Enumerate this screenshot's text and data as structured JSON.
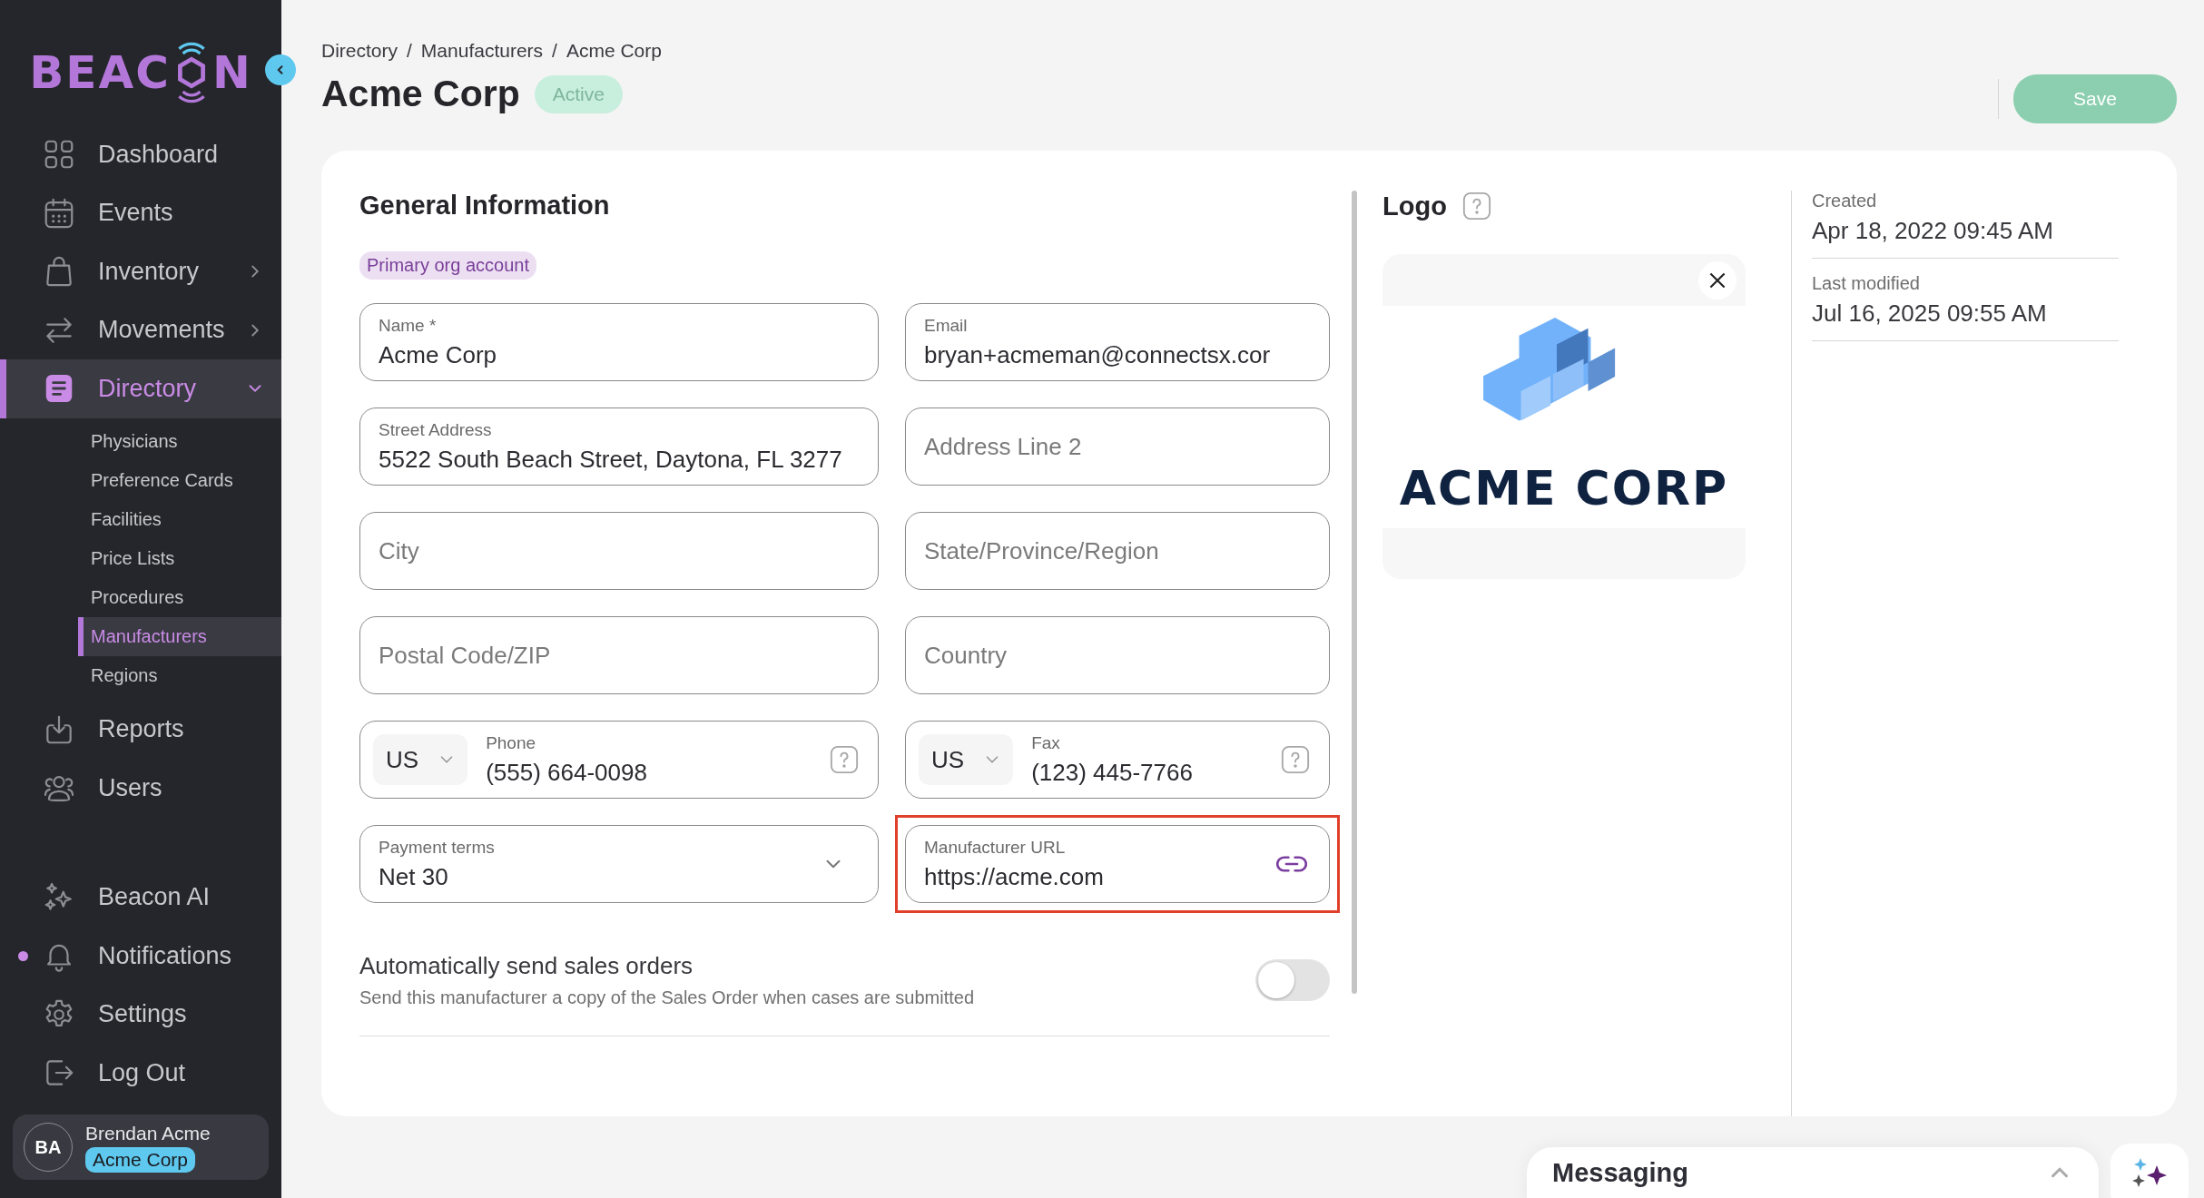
{
  "sidebar": {
    "logo": {
      "before": "BEAC",
      "after": "N"
    },
    "nav": [
      {
        "label": "Dashboard",
        "selected": false
      },
      {
        "label": "Events",
        "selected": false
      },
      {
        "label": "Inventory",
        "expanded": false,
        "selected": false
      },
      {
        "label": "Movements",
        "expanded": false,
        "selected": false
      },
      {
        "label": "Directory",
        "expanded": true,
        "selected": true,
        "children": [
          {
            "label": "Physicians",
            "selected": false
          },
          {
            "label": "Preference Cards",
            "selected": false
          },
          {
            "label": "Facilities",
            "selected": false
          },
          {
            "label": "Price Lists",
            "selected": false
          },
          {
            "label": "Procedures",
            "selected": false
          },
          {
            "label": "Manufacturers",
            "selected": true
          },
          {
            "label": "Regions",
            "selected": false
          }
        ]
      },
      {
        "label": "Reports",
        "selected": false
      },
      {
        "label": "Users",
        "selected": false
      }
    ],
    "nav_bottom": [
      {
        "label": "Beacon AI",
        "unread": false
      },
      {
        "label": "Notifications",
        "unread": true
      },
      {
        "label": "Settings",
        "unread": false
      },
      {
        "label": "Log Out",
        "unread": false
      }
    ],
    "user": {
      "initials": "BA",
      "name": "Brendan Acme",
      "org": "Acme Corp"
    }
  },
  "header": {
    "breadcrumb": [
      "Directory",
      "Manufacturers",
      "Acme Corp"
    ],
    "separator": "/",
    "title": "Acme Corp",
    "status": "Active",
    "save": {
      "label": "Save",
      "disabled": true
    }
  },
  "general": {
    "title": "General Information",
    "tag": "Primary org account",
    "fields": [
      {
        "kind": "text",
        "label": "Name *",
        "value": "Acme Corp",
        "highlighted": false
      },
      {
        "kind": "text",
        "label": "Email",
        "value": "bryan+acmeman@connectsx.cor",
        "highlighted": false
      },
      {
        "kind": "text",
        "label": "Street Address",
        "value": "5522 South Beach Street, Daytona, FL 3277",
        "highlighted": false
      },
      {
        "kind": "text",
        "placeholder": "Address Line 2",
        "highlighted": false
      },
      {
        "kind": "text",
        "placeholder": "City",
        "highlighted": false
      },
      {
        "kind": "text",
        "placeholder": "State/Province/Region",
        "highlighted": false
      },
      {
        "kind": "text",
        "placeholder": "Postal Code/ZIP",
        "highlighted": false
      },
      {
        "kind": "text",
        "placeholder": "Country",
        "highlighted": false
      },
      {
        "kind": "phone",
        "country": "US",
        "label": "Phone",
        "value": "(555) 664-0098",
        "highlighted": false
      },
      {
        "kind": "phone",
        "country": "US",
        "label": "Fax",
        "value": "(123) 445-7766",
        "highlighted": false
      },
      {
        "kind": "select",
        "label": "Payment terms",
        "value": "Net 30",
        "highlighted": false
      },
      {
        "kind": "url",
        "label": "Manufacturer URL",
        "value": "https://acme.com",
        "highlighted": true
      }
    ],
    "auto_send": {
      "title": "Automatically send sales orders",
      "description": "Send this manufacturer a copy of the Sales Order when cases are submitted",
      "on": false
    }
  },
  "logo_panel": {
    "title": "Logo",
    "image_text": "ACME CORP"
  },
  "meta": [
    {
      "label": "Created",
      "value": "Apr 18, 2022 09:45 AM"
    },
    {
      "label": "Last modified",
      "value": "Jul 16, 2025 09:55 AM"
    }
  ],
  "messaging": {
    "title": "Messaging",
    "expanded": false
  }
}
